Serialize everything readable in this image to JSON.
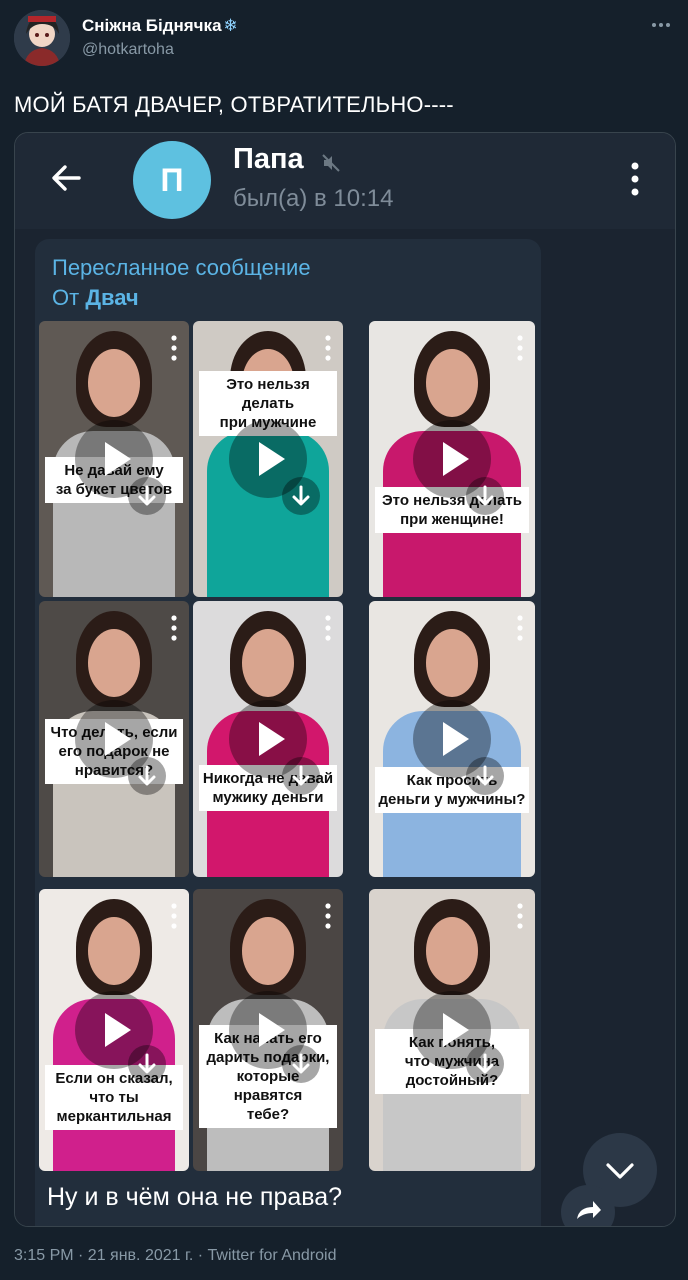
{
  "tweet": {
    "author_name": "Сніжна Біднячка",
    "author_name_emoji": "❄",
    "handle": "@hotkartoha",
    "text": "МОЙ БАТЯ ДВАЧЕР, ОТВРАТИТЕЛЬНО----",
    "footer": "3:15 PM · 21 янв. 2021 г. · Twitter for Android"
  },
  "telegram": {
    "chat_name": "Папа",
    "avatar_letter": "П",
    "status": "был(а) в 10:14",
    "forwarded_label": "Пересланное сообщение",
    "forwarded_from_prefix": "От",
    "forwarded_from_name": "Двач",
    "message_text": "Ну и в чём она не права?",
    "videos": [
      {
        "caption": "Не давай ему\nза букет цветов",
        "outfit": "#b8b8b8"
      },
      {
        "caption": "Это нельзя делать\nпри мужчине",
        "outfit": "#0fa59a"
      },
      {
        "caption": "Это нельзя делать\nпри женщине!",
        "outfit": "#c8186c"
      },
      {
        "caption": "Что делать, если\nего подарок не\nнравится?",
        "outfit": "#c9c4bd"
      },
      {
        "caption": "Никогда не давай\nмужику деньги",
        "outfit": "#d2176c"
      },
      {
        "caption": "Как просить\nденьги у мужчины?",
        "outfit": "#8cb4e0"
      },
      {
        "caption": "Если он сказал,\nчто ты меркантильная",
        "outfit": "#d0208c"
      },
      {
        "caption": "Как начать его\nдарить подарки,\nкоторые нравятся\nтебе?",
        "outfit": "#bdbdbd"
      },
      {
        "caption": "Как понять,\nчто мужчина\nдостойный?",
        "outfit": "#c7c7c7"
      }
    ]
  },
  "colors": {
    "background": "#15202b",
    "link_blue": "#5bb4e5",
    "secondary_text": "#8899a6"
  }
}
